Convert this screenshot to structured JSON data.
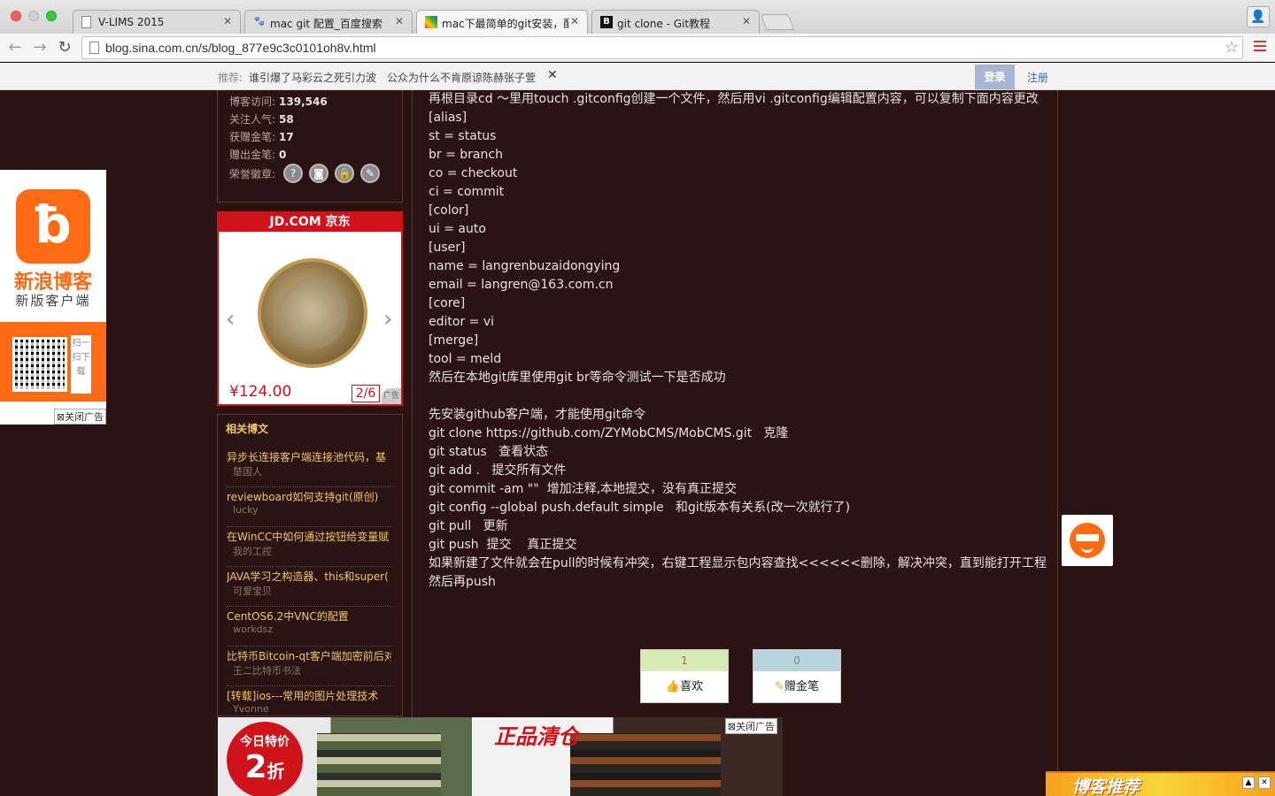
{
  "browser": {
    "tabs": [
      {
        "title": "V-LIMS 2015",
        "favicon": "page-icon",
        "active": false
      },
      {
        "title": "mac git 配置_百度搜索",
        "favicon": "baidu-icon",
        "active": false
      },
      {
        "title": "mac下最简单的git安装，配置",
        "favicon": "sina-icon",
        "active": true
      },
      {
        "title": "git clone - Git教程",
        "favicon": "b-icon",
        "active": false
      }
    ],
    "url": "blog.sina.com.cn/s/blog_877e9c3c0101oh8v.html"
  },
  "sina_bar": {
    "rec_label": "推荐:",
    "news": [
      "谁引爆了马彩云之死引力波",
      "公众为什么不肯原谅陈赫张子萱"
    ],
    "close": "✕",
    "login": "登录",
    "register": "注册"
  },
  "stats": [
    {
      "label": "博客访问:",
      "value": "139,546"
    },
    {
      "label": "关注人气:",
      "value": "58"
    },
    {
      "label": "获赠金笔:",
      "value": "17"
    },
    {
      "label": "赠出金笔:",
      "value": "0"
    }
  ],
  "honor_label": "荣誉徽章:",
  "jd_ad": {
    "header": "JD.COM 京东",
    "price": "¥124.00",
    "counter": "2/6",
    "ad_tag": "广告"
  },
  "related": {
    "title": "相关博文",
    "items": [
      {
        "title": "异步长连接客户端连接池代码，基",
        "author": "楚国人"
      },
      {
        "title": "reviewboard如何支持git(原创)",
        "author": "lucky"
      },
      {
        "title": "在WinCC中如何通过按钮给变量赋",
        "author": "我的工控"
      },
      {
        "title": "JAVA学习之构造器、this和super(",
        "author": "可爱宝贝"
      },
      {
        "title": "CentOS6.2中VNC的配置",
        "author": "workdsz"
      },
      {
        "title": "比特币Bitcoin-qt客户端加密前后对",
        "author": "王二比特币书法"
      },
      {
        "title": "[转载]ios---常用的图片处理技术",
        "author": "Yvonne"
      }
    ]
  },
  "article_lines": [
    "再根目录cd ～里用touch .gitconfig创建一个文件，然后用vi .gitconfig编辑配置内容，可以复制下面内容更改",
    "[alias]",
    "st = status",
    "br = branch",
    "co = checkout",
    "ci = commit",
    "[color]",
    "ui = auto",
    "[user]",
    "name = langrenbuzaidongying",
    "email = langren@163.com.cn",
    "[core]",
    "editor = vi",
    "[merge]",
    "tool = meld",
    "然后在本地git库里使用git br等命令测试一下是否成功",
    "",
    "先安装github客户端，才能使用git命令",
    "git clone https://github.com/ZYMobCMS/MobCMS.git   克隆",
    "git status   查看状态",
    "git add .   提交所有文件",
    "git commit -am \"\"  增加注释,本地提交，没有真正提交",
    "git config --global push.default simple   和git版本有关系(改一次就行了)",
    "git pull   更新",
    "git push  提交    真正提交",
    "如果新建了文件就会在pull的时候有冲突，右键工程显示包内容查找<<<<<<删除，解决冲突，直到能打开工程",
    "然后再push"
  ],
  "votes": {
    "like_count": "1",
    "like_label": "喜欢",
    "gift_count": "0",
    "gift_label": "赠金笔"
  },
  "app_promo": {
    "name": "新浪博客",
    "sub": "新版客户端",
    "scan": "扫一扫下载",
    "close": "关闭广告"
  },
  "bottom_ad": {
    "badge_line1": "今日特价",
    "badge_num": "2",
    "badge_unit": "折",
    "headline": "正品清仓",
    "close": "关闭广告"
  },
  "blog_recommend": {
    "title": "博客推荐"
  },
  "colors": {
    "page_bg": "#2a1312",
    "accent_orange": "#ff6a13",
    "jd_red": "#d1111b",
    "link_gold": "#f0c85a"
  }
}
